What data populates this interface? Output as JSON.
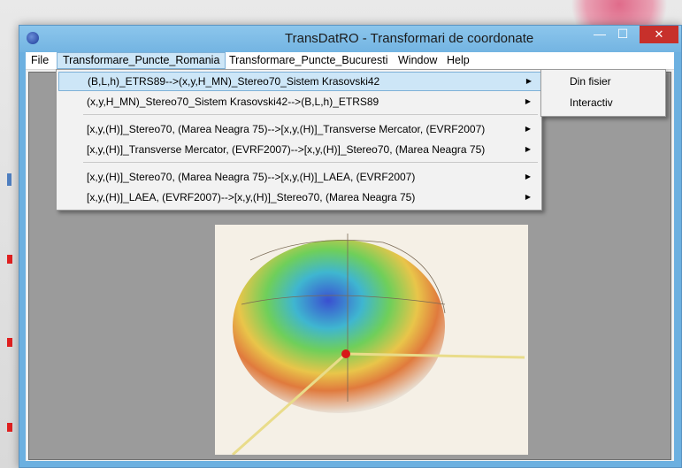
{
  "window": {
    "title": "TransDatRO - Transformari de coordonate",
    "close_glyph": "✕",
    "minimize_glyph": "—",
    "maximize_glyph": "☐"
  },
  "menubar": {
    "items": [
      {
        "label": "File"
      },
      {
        "label": "Transformare_Puncte_Romania"
      },
      {
        "label": "Transformare_Puncte_Bucuresti"
      },
      {
        "label": "Window"
      },
      {
        "label": "Help"
      }
    ]
  },
  "dropdown": {
    "items": [
      {
        "label": "(B,L,h)_ETRS89-->(x,y,H_MN)_Stereo70_Sistem Krasovski42"
      },
      {
        "label": "(x,y,H_MN)_Stereo70_Sistem Krasovski42-->(B,L,h)_ETRS89"
      },
      {
        "label": "[x,y,(H)]_Stereo70, (Marea Neagra 75)-->[x,y,(H)]_Transverse Mercator, (EVRF2007)"
      },
      {
        "label": "[x,y,(H)]_Transverse Mercator, (EVRF2007)-->[x,y,(H)]_Stereo70, (Marea Neagra 75)"
      },
      {
        "label": "[x,y,(H)]_Stereo70, (Marea Neagra 75)-->[x,y,(H)]_LAEA, (EVRF2007)"
      },
      {
        "label": "[x,y,(H)]_LAEA, (EVRF2007)-->[x,y,(H)]_Stereo70, (Marea Neagra 75)"
      }
    ],
    "arrow_glyph": "▶"
  },
  "submenu": {
    "items": [
      {
        "label": "Din fisier"
      },
      {
        "label": "Interactiv"
      }
    ]
  },
  "colors": {
    "titlebar": "#73b4e2",
    "highlight": "#cde6f7",
    "close": "#c7302b"
  },
  "icons": [
    "app-globe-icon",
    "submenu-arrow-icon",
    "close-icon",
    "minimize-icon",
    "maximize-icon"
  ]
}
